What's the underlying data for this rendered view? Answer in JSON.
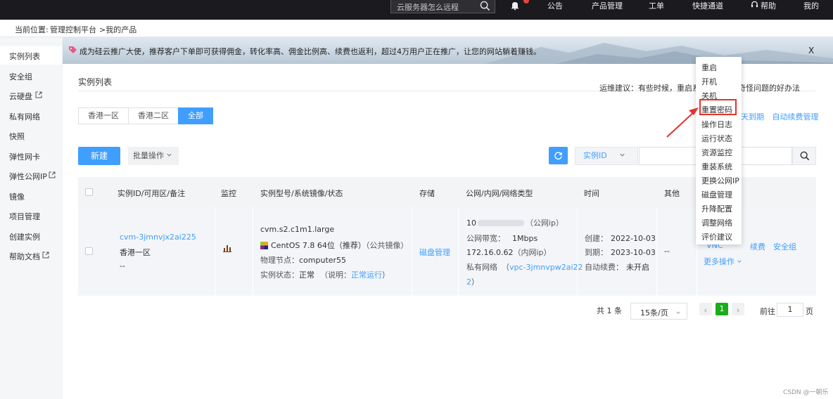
{
  "topbar": {
    "search_placeholder": "云服务器怎么远程",
    "nav": [
      "公告",
      "产品管理",
      "工单",
      "快捷通道",
      "帮助",
      "我的"
    ]
  },
  "breadcrumb": {
    "prefix": "当前位置:",
    "path1": "管理控制平台",
    "path2": ">我的产品"
  },
  "sidebar": {
    "items": [
      "实例列表",
      "安全组",
      "云硬盘",
      "私有网络",
      "快照",
      "弹性网卡",
      "弹性公网IP",
      "镜像",
      "项目管理",
      "创建实例",
      "帮助文档"
    ]
  },
  "banner": {
    "text": "成为硅云推广大使，推荐客户下单即可获得佣金，转化率高、佣金比例高、续费也返利，超过4万用户正在推广，让您的网站躺着赚钱。",
    "close": "X"
  },
  "main": {
    "title": "实例列表",
    "tip": "运维建议：有些时候，重启系统可能是解决奇怪问题的好办法",
    "tip_visible": "运维建议：有些时候，重启系统",
    "tip_tail": "决奇怪问题的好办法",
    "region_tabs": [
      "香港一区",
      "香港二区",
      "全部"
    ],
    "expire_text": "天到期",
    "auto_renew": "自动续费管理",
    "new_button": "新建",
    "batch_button": "批量操作",
    "id_select": "实例ID"
  },
  "table": {
    "headers": [
      "实例ID/可用区/备注",
      "监控",
      "实例型号/系统镜像/状态",
      "存储",
      "公网/内网/网络类型",
      "时间",
      "其他"
    ],
    "row": {
      "instance_id": "cvm-3jmnvjx2ai225",
      "zone": "香港一区",
      "remark": "--",
      "model": "cvm.s2.c1m1.large",
      "os": "CentOS 7.8 64位（推荐）（公共镜像）",
      "os_name": "CentOS 7.8 64位",
      "os_rec": "（推荐）",
      "os_pub": "（公共镜像）",
      "node_label": "物理节点：",
      "node": "computer55",
      "status_label": "实例状态：",
      "status": "正常",
      "status_note_prefix": "（说明：",
      "status_note": "正常运行",
      "status_note_suffix": "）",
      "storage_link": "磁盘管理",
      "public_ip_suffix": "（公网ip）",
      "ip_prefix": "10",
      "bandwidth_label": "公网带宽：",
      "bandwidth": "1Mbps",
      "private_ip": "172.16.0.62",
      "private_ip_suffix": "（内网ip）",
      "vpc_label": "私有网络",
      "vpc_open": "（",
      "vpc": "vpc-3jmnvpw2ai22",
      "vpc_cont": "2",
      "vpc_close": "）",
      "created_label": "创建：",
      "created": "2022-10-03",
      "expire_label": "到期：",
      "expire": "2023-10-03",
      "autorenew_label": "自动续费：",
      "autorenew": "未开启",
      "other": "--",
      "ops": [
        "VNC",
        "续费",
        "安全组"
      ],
      "more_ops": "更多操作"
    }
  },
  "pagination": {
    "total": "共 1 条",
    "page_size": "15条/页",
    "current": "1",
    "goto_label": "前往",
    "goto_value": "1",
    "page_suffix": "页"
  },
  "dropdown": {
    "items": [
      "重启",
      "开机",
      "关机",
      "重置密码",
      "操作日志",
      "运行状态",
      "资源监控",
      "重装系统",
      "更换公网IP",
      "磁盘管理",
      "升降配置",
      "调整网络",
      "评价建议"
    ],
    "highlighted": "重置密码"
  },
  "watermark": "CSDN @一朝乐",
  "colors": {
    "accent": "#409eff",
    "highlight": "#e5322d",
    "current_page": "#1aad19"
  }
}
